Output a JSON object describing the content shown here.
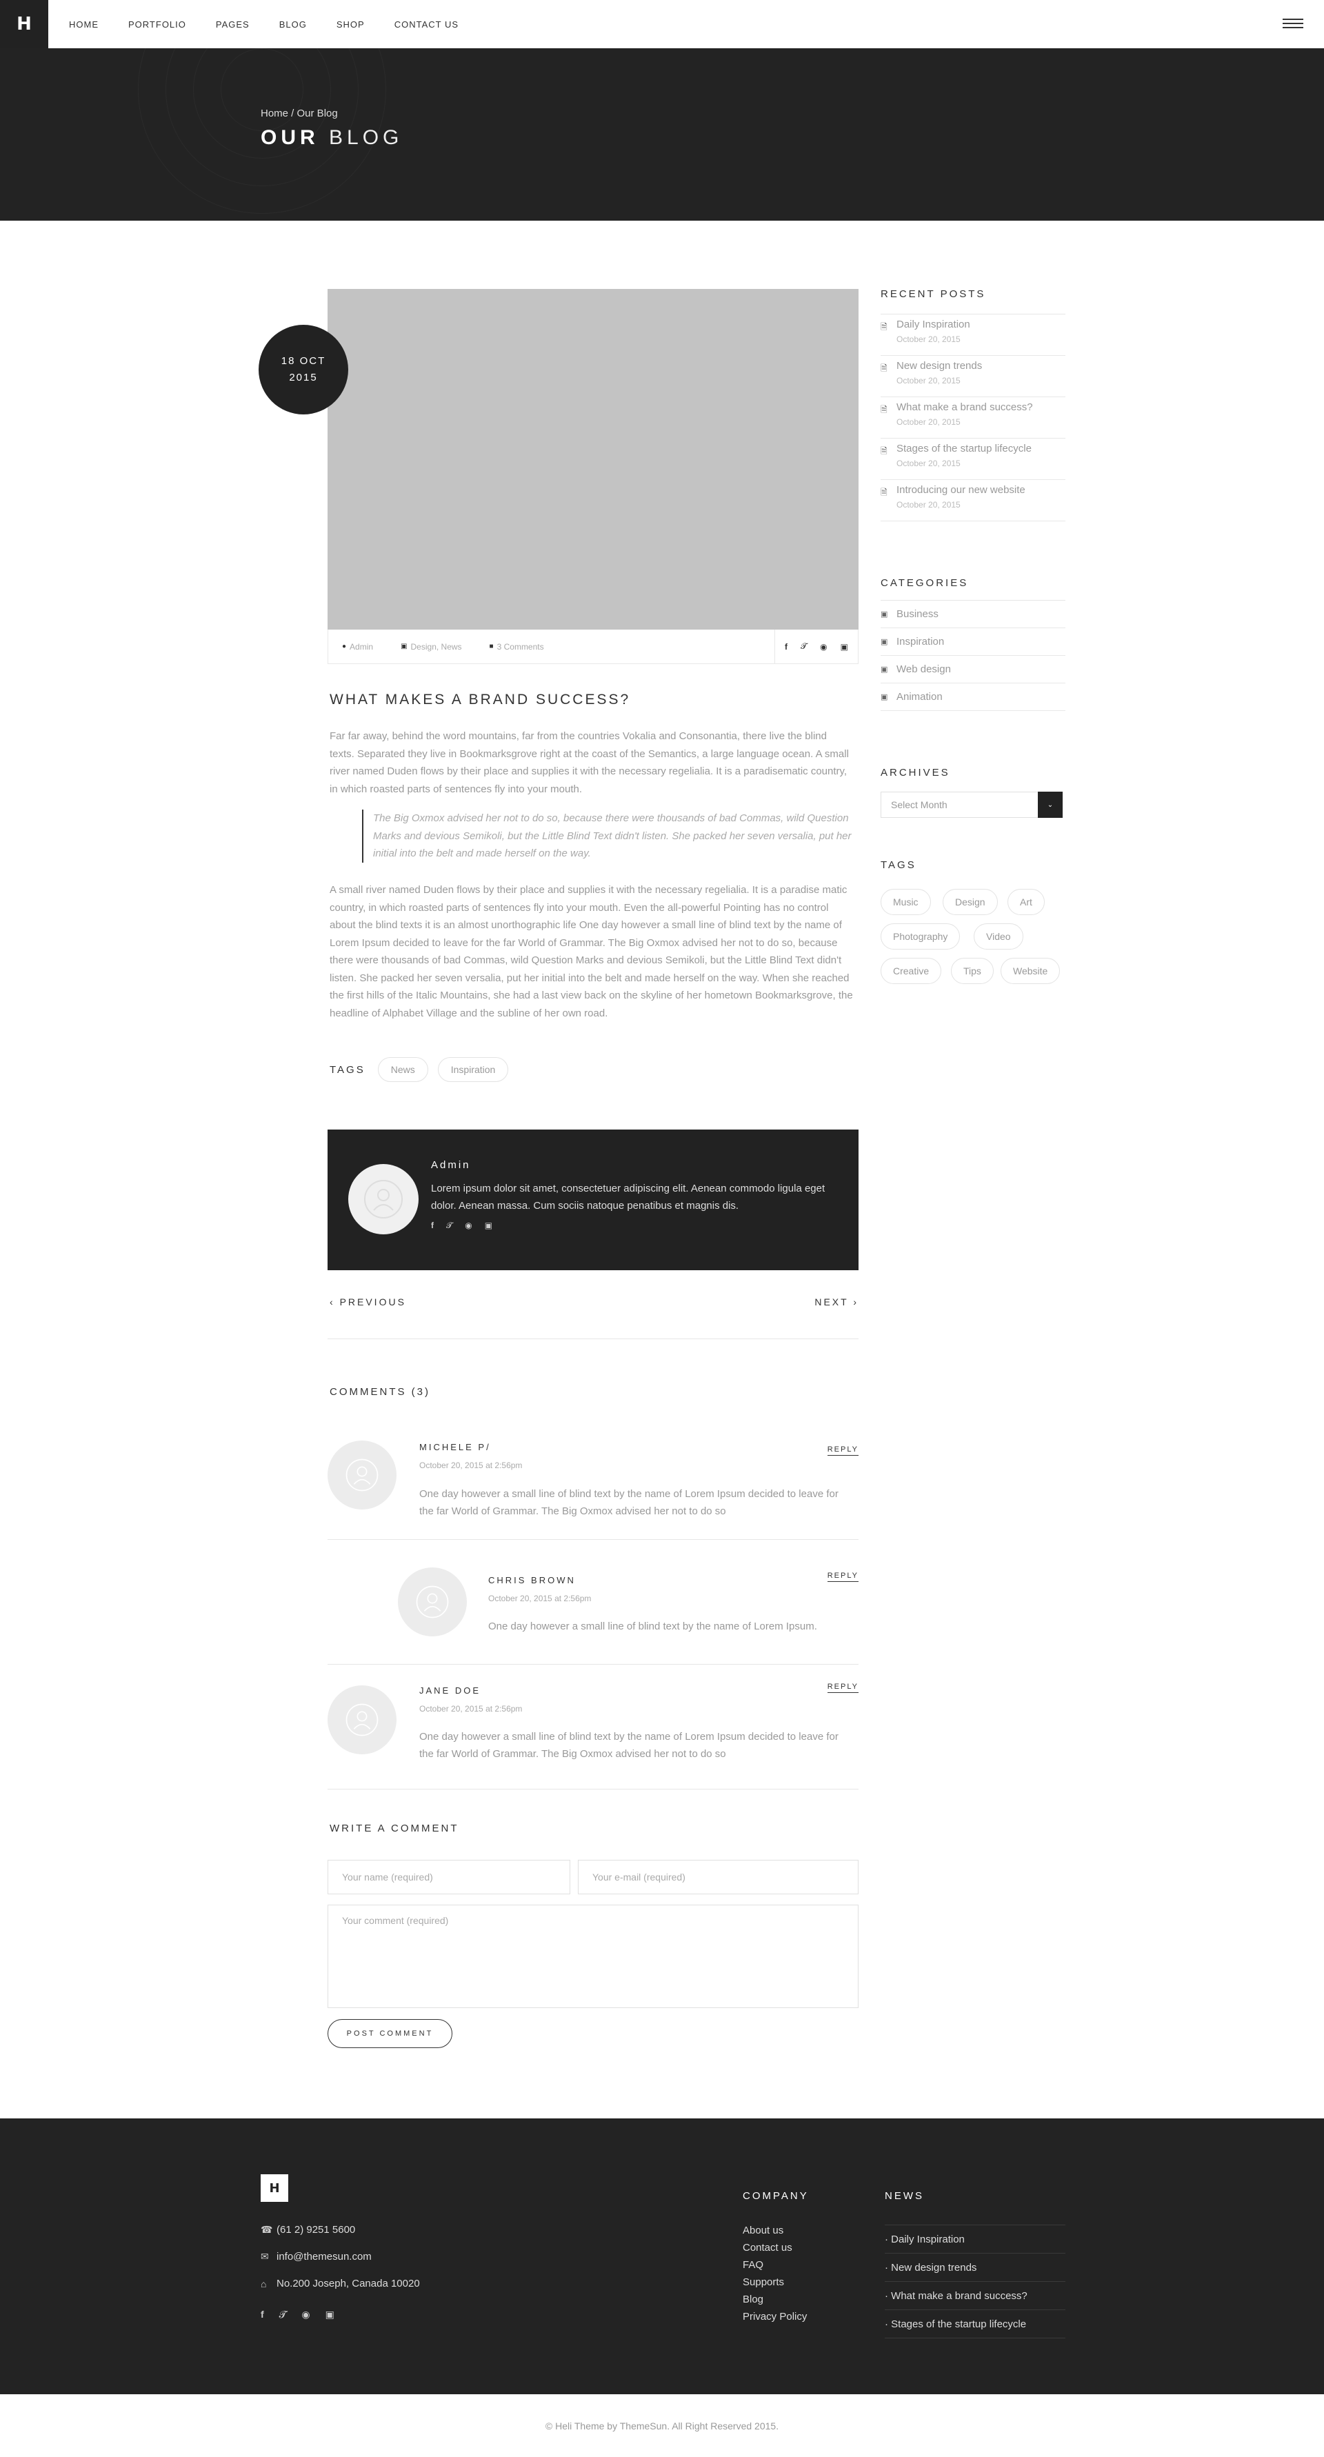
{
  "header": {
    "logo": "H",
    "nav": [
      "HOME",
      "PORTFOLIO",
      "PAGES",
      "BLOG",
      "SHOP",
      "CONTACT US"
    ]
  },
  "hero": {
    "breadcrumb": "Home / Our Blog",
    "title_bold": "OUR",
    "title_light": "BLOG"
  },
  "post": {
    "date_day": "18 OCT",
    "date_year": "2015",
    "meta_author": "Admin",
    "meta_categories": "Design, News",
    "meta_comments": "3 Comments",
    "social_icons": [
      "facebook-icon",
      "twitter-icon",
      "pinterest-icon",
      "instagram-icon"
    ],
    "title": "WHAT MAKES A BRAND SUCCESS?",
    "paragraph1": "Far far away, behind the word mountains, far from the countries Vokalia and Consonantia, there live the blind texts. Separated they live in Bookmarksgrove right at the coast of the Semantics, a large language ocean. A small river named Duden flows by their place and supplies it with the necessary regelialia. It is a paradisematic country, in which roasted parts of sentences fly into your mouth.",
    "quote": "The Big Oxmox advised her not to do so, because there were thousands of bad Commas, wild Question Marks and devious Semikoli, but the Little Blind Text didn't listen. She packed her seven versalia, put her initial into the belt and made herself on the way.",
    "paragraph2": "A small river named Duden flows by their place and supplies it with the necessary regelialia. It is a paradise matic country, in which roasted parts of sentences fly into your mouth. Even the all-powerful Pointing has no control about the blind texts it is an almost unorthographic life One day however a small line of blind text by the name of Lorem Ipsum decided to leave for the far World of Grammar. The Big Oxmox advised her not to do so, because there were thousands of bad Commas, wild Question Marks and devious Semikoli, but the Little Blind Text didn't listen. She packed her seven versalia, put her initial into the belt and made herself on the way. When she reached the first hills of the Italic Mountains, she had a last view back on the skyline of her hometown Bookmarksgrove, the headline of Alphabet Village and the subline of her own road.",
    "tags_label": "TAGS",
    "tags": [
      "News",
      "Inspiration"
    ]
  },
  "author": {
    "name": "Admin",
    "bio": "Lorem ipsum dolor sit amet, consectetuer adipiscing elit. Aenean commodo ligula eget dolor. Aenean massa. Cum sociis natoque penatibus et magnis dis."
  },
  "pagination": {
    "previous": "PREVIOUS",
    "next": "NEXT"
  },
  "comments": {
    "title": "COMMENTS (3)",
    "reply_label": "REPLY",
    "items": [
      {
        "name": "MICHELE P/",
        "date": "October 20, 2015 at 2:56pm",
        "text": "One day however a small line of blind text by the name of Lorem Ipsum decided to leave for the far World of Grammar. The Big Oxmox advised her not to do so"
      },
      {
        "name": "CHRIS BROWN",
        "date": "October 20, 2015 at 2:56pm",
        "text": "One day however a small line of blind text by the name of Lorem Ipsum."
      },
      {
        "name": "JANE DOE",
        "date": "October 20, 2015 at 2:56pm",
        "text": "One day however a small line of blind text by the name of Lorem Ipsum decided to leave for the far World of Grammar. The Big Oxmox advised her not to do so"
      }
    ]
  },
  "comment_form": {
    "title": "WRITE A COMMENT",
    "name_placeholder": "Your name (required)",
    "email_placeholder": "Your e-mail (required)",
    "comment_placeholder": "Your comment (required)",
    "submit": "POST COMMENT"
  },
  "sidebar": {
    "recent_title": "RECENT POSTS",
    "recent": [
      {
        "title": "Daily Inspiration",
        "date": "October 20, 2015"
      },
      {
        "title": "New design trends",
        "date": "October 20, 2015"
      },
      {
        "title": "What make a brand success?",
        "date": "October 20, 2015"
      },
      {
        "title": "Stages of the startup lifecycle",
        "date": "October 20, 2015"
      },
      {
        "title": "Introducing our new website",
        "date": "October 20, 2015"
      }
    ],
    "categories_title": "CATEGORIES",
    "categories": [
      "Business",
      "Inspiration",
      "Web design",
      "Animation"
    ],
    "archives_title": "ARCHIVES",
    "archives_select": "Select Month",
    "tags_title": "TAGS",
    "tags": [
      "Music",
      "Design",
      "Art",
      "Photography",
      "Video",
      "Creative",
      "Tips",
      "Website"
    ]
  },
  "footer": {
    "logo": "H",
    "phone": "(61 2) 9251 5600",
    "email": "info@themesun.com",
    "address": "No.200 Joseph, Canada 10020",
    "company_title": "COMPANY",
    "company_links": [
      "About us",
      "Contact us",
      "FAQ",
      "Supports",
      "Blog",
      "Privacy Policy"
    ],
    "news_title": "NEWS",
    "news": [
      "Daily Inspiration",
      "New design trends",
      "What make a brand success?",
      "Stages of the startup lifecycle"
    ],
    "copyright": "© Heli Theme by ThemeSun. All Right Reserved 2015."
  },
  "colors": {
    "dark": "#232323",
    "image_placeholder": "#c3c3c3",
    "muted_text": "#999999"
  }
}
